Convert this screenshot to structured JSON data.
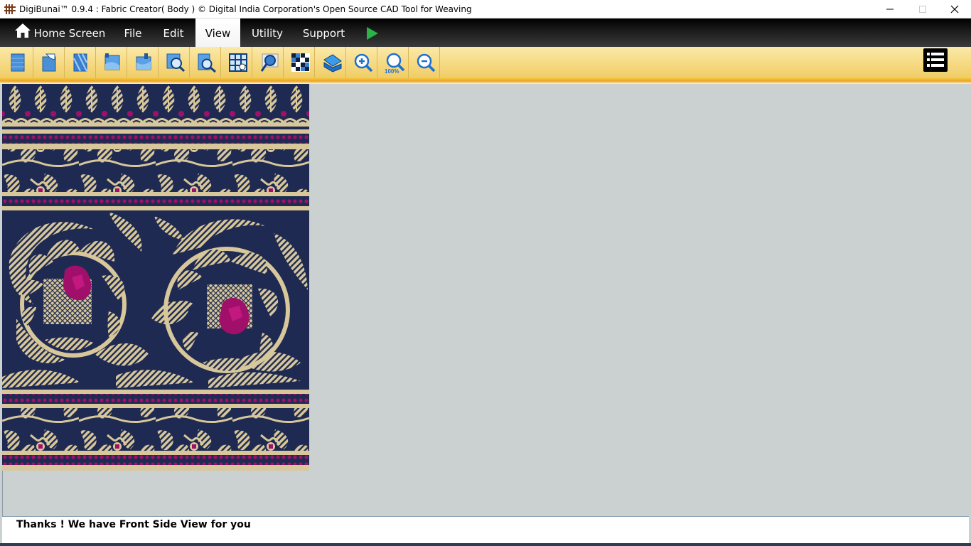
{
  "window": {
    "title": "DigiBunai™ 0.9.4 : Fabric Creator( Body ) © Digital India Corporation's Open Source CAD Tool for Weaving",
    "minimize_icon": "minimize-icon",
    "maximize_icon": "maximize-icon",
    "close_icon": "close-icon"
  },
  "menubar": {
    "home_label": "Home Screen",
    "file_label": "File",
    "edit_label": "Edit",
    "view_label": "View",
    "utility_label": "Utility",
    "support_label": "Support",
    "active": "View",
    "run_icon": "play-icon"
  },
  "toolbar": {
    "tools": [
      "front-side-view-icon",
      "rear-side-view-icon",
      "visualization-view-icon",
      "crossection-front-icon",
      "crossection-rear-icon",
      "grid-view-icon",
      "graph-view-icon",
      "tiled-view-icon",
      "simulation-view-icon",
      "weave-pattern-icon",
      "fabric-3d-icon",
      "zoom-in-icon",
      "zoom-normal-icon",
      "zoom-out-icon"
    ],
    "zoom_normal_text": "100%",
    "menu_icon": "list-menu-icon"
  },
  "colors": {
    "fabric_navy": "#1f2a52",
    "fabric_gold": "#d7c79a",
    "fabric_magenta": "#a0106a",
    "canvas_bg": "#cbd0d1",
    "toolbar_bg": "#f5d87e",
    "accent_green": "#28b446"
  },
  "status": {
    "message": "Thanks ! We have Front Side View for you"
  }
}
